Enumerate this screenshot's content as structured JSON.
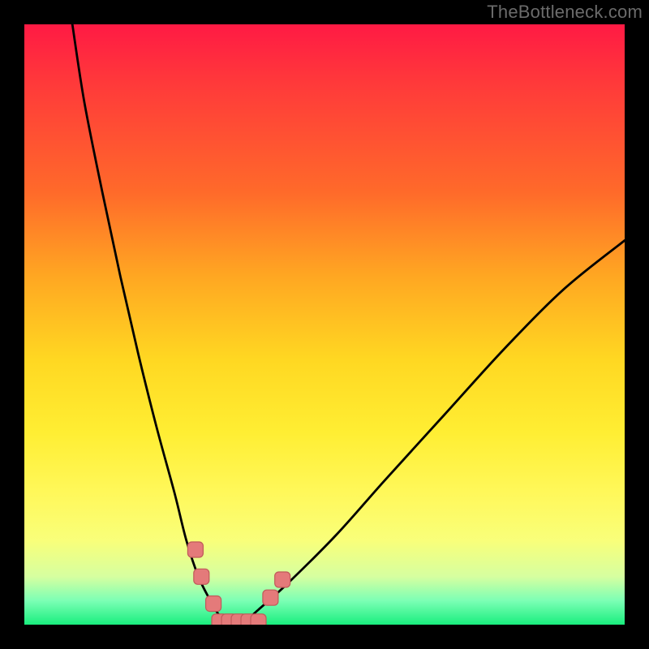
{
  "watermark": "TheBottleneck.com",
  "chart_data": {
    "type": "line",
    "title": "",
    "xlabel": "",
    "ylabel": "",
    "xlim": [
      0,
      100
    ],
    "ylim": [
      0,
      100
    ],
    "grid": false,
    "note": "No axes or tick labels rendered; values are estimated from pixel positions on a 0–100 normalized scale matching the 740×740 plot area.",
    "series": [
      {
        "name": "bottleneck-curve",
        "color": "#000000",
        "x": [
          8,
          10,
          13,
          16,
          19,
          22,
          25,
          27,
          29,
          31,
          32.5,
          34,
          36,
          39,
          44,
          52,
          60,
          70,
          80,
          90,
          100
        ],
        "y": [
          100,
          87,
          72,
          58,
          45,
          33,
          22,
          14,
          8,
          4,
          1.5,
          0,
          0,
          2.5,
          7,
          15,
          24,
          35,
          46,
          56,
          64
        ]
      }
    ],
    "markers": [
      {
        "name": "left-cluster-top",
        "x": 28.5,
        "y": 12.5
      },
      {
        "name": "left-cluster-mid",
        "x": 29.5,
        "y": 8.0
      },
      {
        "name": "left-cluster-bottom",
        "x": 31.5,
        "y": 3.5
      },
      {
        "name": "right-cluster-lower",
        "x": 41.0,
        "y": 4.5
      },
      {
        "name": "right-cluster-upper",
        "x": 43.0,
        "y": 7.5
      }
    ],
    "baseline_run": {
      "name": "global-minimum-run",
      "x_start": 32.5,
      "x_end": 39.0,
      "y": 0.5
    }
  }
}
